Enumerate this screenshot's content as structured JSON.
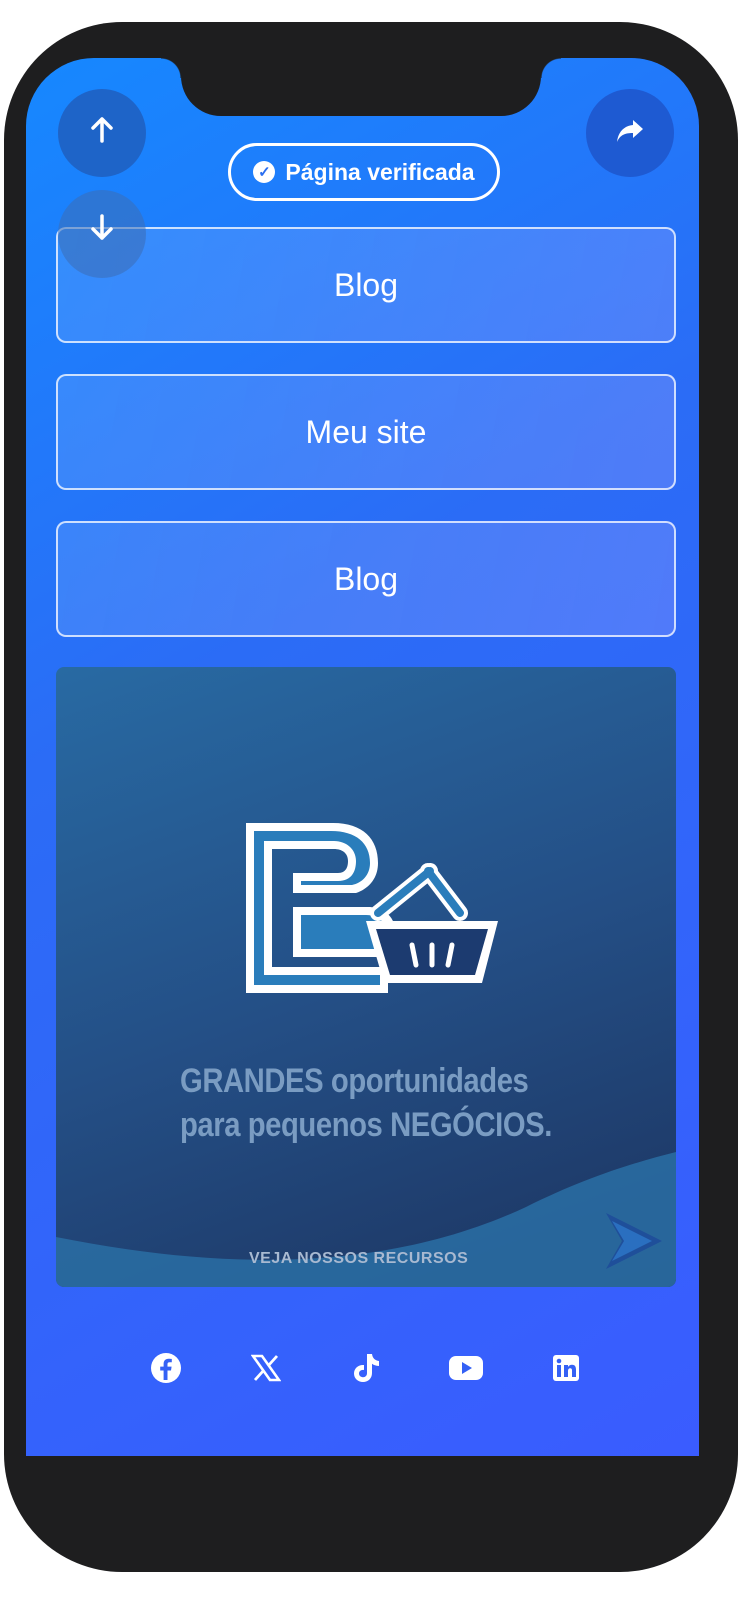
{
  "header": {
    "scroll_up_icon": "arrow-up-icon",
    "scroll_down_icon": "arrow-down-icon",
    "share_icon": "share-arrow-icon",
    "verified_label": "Página verificada"
  },
  "links": [
    {
      "label": "Blog"
    },
    {
      "label": "Meu site"
    },
    {
      "label": "Blog"
    }
  ],
  "banner": {
    "headline_line1": "GRANDES oportunidades",
    "headline_line2": "para pequenos NEGÓCIOS.",
    "cta": "VEJA NOSSOS RECURSOS"
  },
  "socials": [
    {
      "icon": "facebook-icon"
    },
    {
      "icon": "x-icon"
    },
    {
      "icon": "tiktok-icon"
    },
    {
      "icon": "youtube-icon"
    },
    {
      "icon": "linkedin-icon"
    }
  ],
  "colors": {
    "background_gradient_start": "#1688ff",
    "background_gradient_end": "#3a5cff",
    "phone_frame": "#1e1e1f",
    "banner_dark": "#1c3460"
  }
}
